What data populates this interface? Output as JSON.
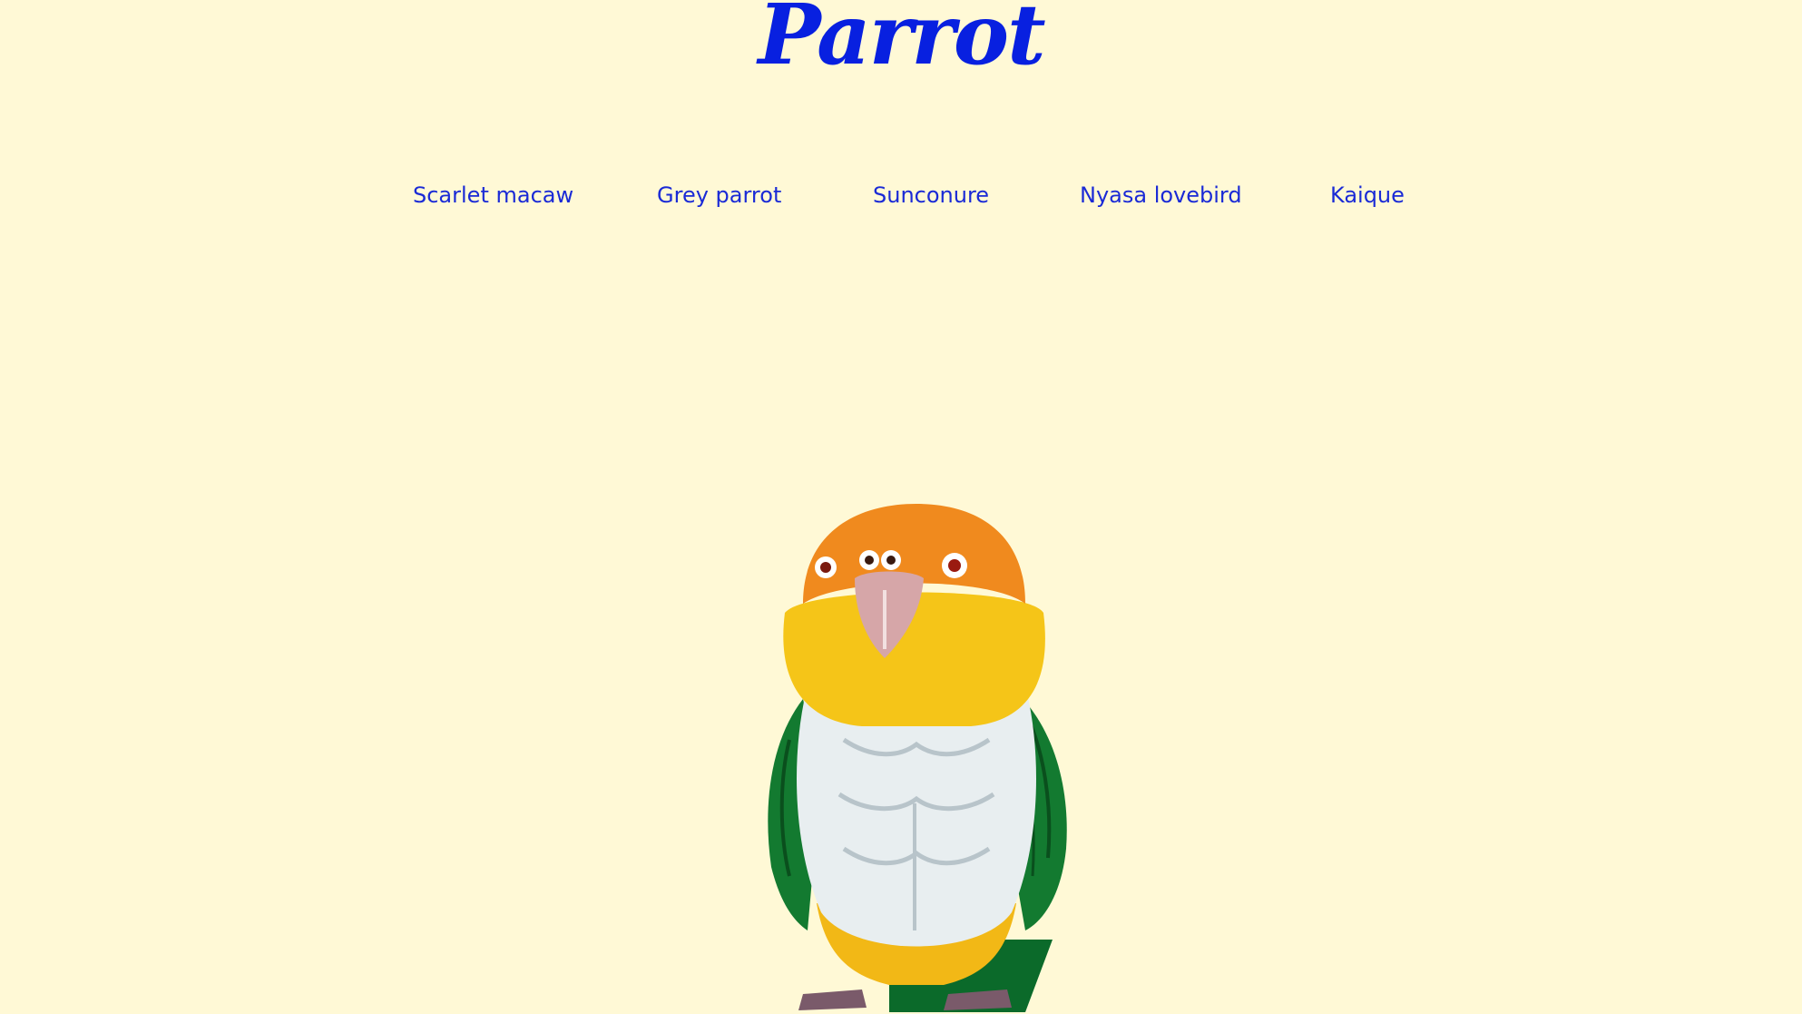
{
  "header": {
    "title": "Parrot"
  },
  "nav": {
    "items": [
      {
        "label": "Scarlet macaw"
      },
      {
        "label": "Grey parrot"
      },
      {
        "label": "Sunconure"
      },
      {
        "label": "Nyasa lovebird"
      },
      {
        "label": "Kaique"
      }
    ]
  },
  "colors": {
    "background": "#fff9d6",
    "title": "#0820e0",
    "link": "#1a2ad6"
  }
}
